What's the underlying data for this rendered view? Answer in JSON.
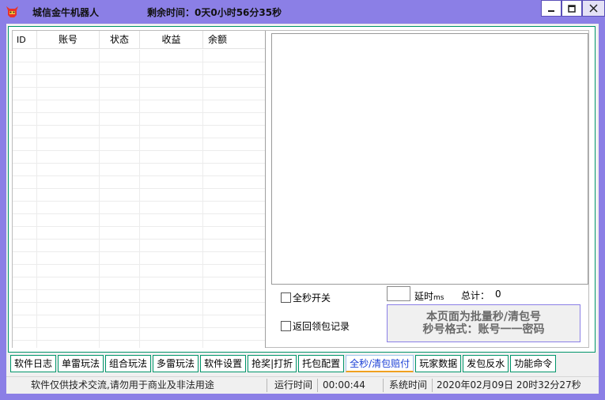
{
  "window": {
    "title": "城信金牛机器人",
    "countdown": "剩余时间：0天0小时56分35秒"
  },
  "grid": {
    "columns": [
      "ID",
      "账号",
      "状态",
      "收益",
      "余额"
    ],
    "rows": []
  },
  "controls": {
    "all_seconds_toggle": "全秒开关",
    "return_record": "返回领包记录",
    "delay_label": "延时",
    "delay_unit": "ms",
    "delay_value": "",
    "total_label": "总计：",
    "total_value": "0",
    "hint_line1": "本页面为批量秒/清包号",
    "hint_line2": "秒号格式：账号一一密码"
  },
  "tabs": [
    {
      "label": "软件日志"
    },
    {
      "label": "单雷玩法"
    },
    {
      "label": "组合玩法"
    },
    {
      "label": "多雷玩法"
    },
    {
      "label": "软件设置"
    },
    {
      "label": "抢奖|打折"
    },
    {
      "label": "托包配置"
    },
    {
      "label": "全秒/清包赔付",
      "active": true
    },
    {
      "label": "玩家数据"
    },
    {
      "label": "发包反水"
    },
    {
      "label": "功能命令"
    }
  ],
  "statusbar": {
    "notice": "软件仅供技术交流,请勿用于商业及非法用途",
    "runtime_label": "运行时间",
    "runtime_value": "00:00:44",
    "systime_label": "系统时间",
    "systime_value": "2020年02月09日 20时32分27秒"
  },
  "colors": {
    "titlebar": "#8b7fe6",
    "frame_border": "#00956a",
    "active_tab_text": "#1a3fd6"
  }
}
